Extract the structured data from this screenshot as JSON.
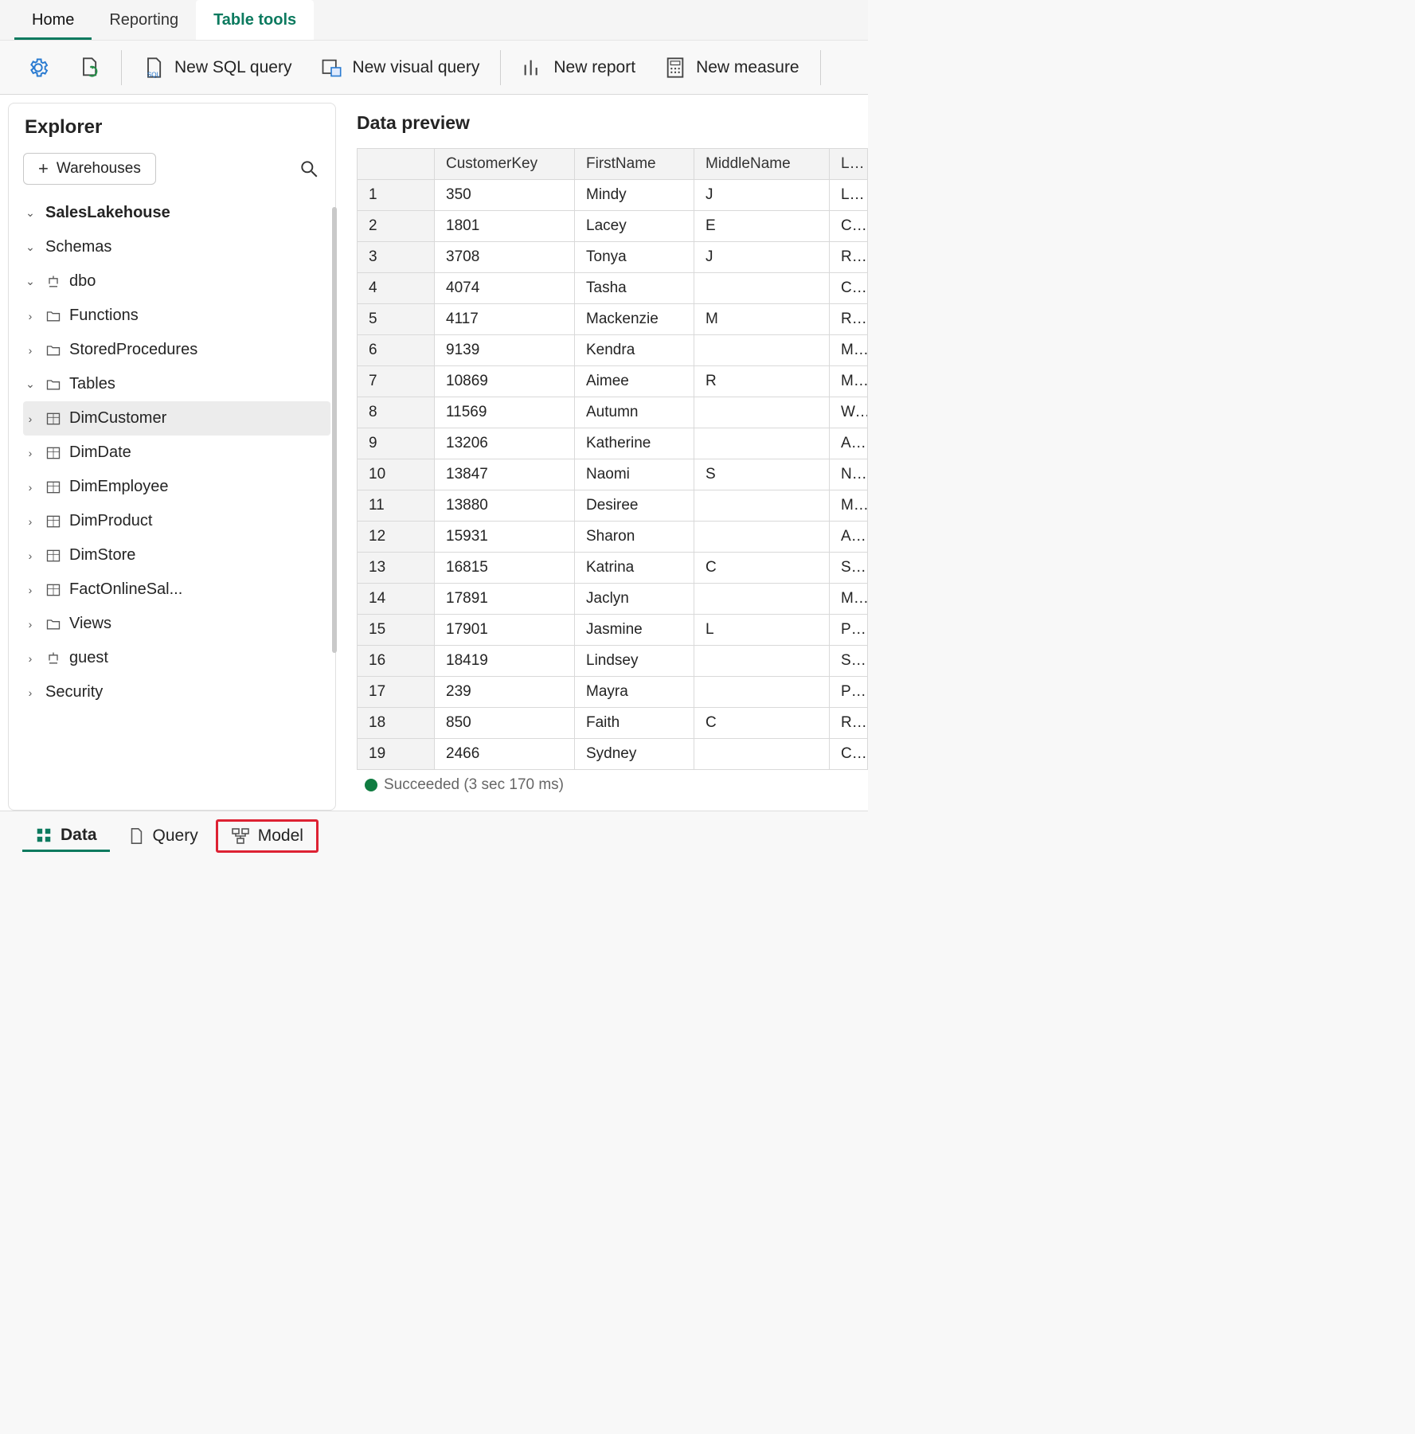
{
  "tabs": {
    "home": "Home",
    "reporting": "Reporting",
    "tools": "Table tools"
  },
  "ribbon": {
    "newSql": "New SQL query",
    "newVisual": "New visual query",
    "newReport": "New report",
    "newMeasure": "New measure"
  },
  "explorer": {
    "title": "Explorer",
    "warehouses": "Warehouses",
    "db": "SalesLakehouse",
    "schemas": "Schemas",
    "dbo": "dbo",
    "functions": "Functions",
    "sp": "StoredProcedures",
    "tables": "Tables",
    "t1": "DimCustomer",
    "t2": "DimDate",
    "t3": "DimEmployee",
    "t4": "DimProduct",
    "t5": "DimStore",
    "t6": "FactOnlineSal...",
    "views": "Views",
    "guest": "guest",
    "security": "Security"
  },
  "preview": {
    "title": "Data preview",
    "headers": {
      "c1": "CustomerKey",
      "c2": "FirstName",
      "c3": "MiddleName",
      "c4": "LastNa"
    },
    "rows": [
      {
        "n": "1",
        "k": "350",
        "f": "Mindy",
        "m": "J",
        "l": "Luo"
      },
      {
        "n": "2",
        "k": "1801",
        "f": "Lacey",
        "m": "E",
        "l": "Chen"
      },
      {
        "n": "3",
        "k": "3708",
        "f": "Tonya",
        "m": "J",
        "l": "Raje"
      },
      {
        "n": "4",
        "k": "4074",
        "f": "Tasha",
        "m": "",
        "l": "Chande"
      },
      {
        "n": "5",
        "k": "4117",
        "f": "Mackenzie",
        "m": "M",
        "l": "Ramire"
      },
      {
        "n": "6",
        "k": "9139",
        "f": "Kendra",
        "m": "",
        "l": "Moren"
      },
      {
        "n": "7",
        "k": "10869",
        "f": "Aimee",
        "m": "R",
        "l": "Ma"
      },
      {
        "n": "8",
        "k": "11569",
        "f": "Autumn",
        "m": "",
        "l": "Wu"
      },
      {
        "n": "9",
        "k": "13206",
        "f": "Katherine",
        "m": "",
        "l": "Anders"
      },
      {
        "n": "10",
        "k": "13847",
        "f": "Naomi",
        "m": "S",
        "l": "Navarr"
      },
      {
        "n": "11",
        "k": "13880",
        "f": "Desiree",
        "m": "",
        "l": "Munoz"
      },
      {
        "n": "12",
        "k": "15931",
        "f": "Sharon",
        "m": "",
        "l": "Anders"
      },
      {
        "n": "13",
        "k": "16815",
        "f": "Katrina",
        "m": "C",
        "l": "Shan"
      },
      {
        "n": "14",
        "k": "17891",
        "f": "Jaclyn",
        "m": "",
        "l": "Ma"
      },
      {
        "n": "15",
        "k": "17901",
        "f": "Jasmine",
        "m": "L",
        "l": "Price"
      },
      {
        "n": "16",
        "k": "18419",
        "f": "Lindsey",
        "m": "",
        "l": "Sharma"
      },
      {
        "n": "17",
        "k": "239",
        "f": "Mayra",
        "m": "",
        "l": "Prasad"
      },
      {
        "n": "18",
        "k": "850",
        "f": "Faith",
        "m": "C",
        "l": "Reed"
      },
      {
        "n": "19",
        "k": "2466",
        "f": "Sydney",
        "m": "",
        "l": "Campb"
      }
    ],
    "status": "Succeeded (3 sec 170 ms)"
  },
  "views": {
    "data": "Data",
    "query": "Query",
    "model": "Model"
  }
}
